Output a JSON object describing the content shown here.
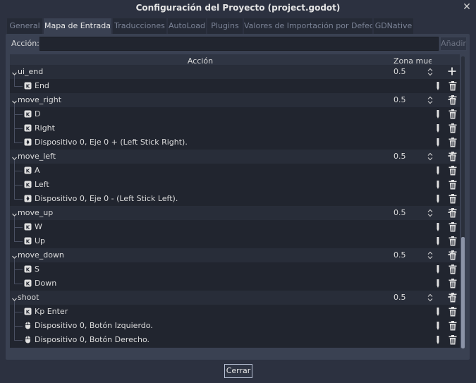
{
  "window": {
    "title": "Configuración del Proyecto (project.godot)"
  },
  "tabs": [
    {
      "label": "General",
      "active": false
    },
    {
      "label": "Mapa de Entrada",
      "active": true
    },
    {
      "label": "Traducciones",
      "active": false
    },
    {
      "label": "AutoLoad",
      "active": false
    },
    {
      "label": "Plugins",
      "active": false
    },
    {
      "label": "Valores de Importación por Defecto",
      "active": false
    },
    {
      "label": "GDNative",
      "active": false
    }
  ],
  "action_bar": {
    "label": "Acción:",
    "input_value": "",
    "add_button": "Añadir"
  },
  "tree": {
    "header_action": "Acción",
    "header_deadzone": "Zona muer",
    "rows": [
      {
        "type": "action",
        "name": "ui_end",
        "deadzone": "0.5"
      },
      {
        "type": "event",
        "icon": "keyboard-icon",
        "name": "End"
      },
      {
        "type": "action",
        "name": "move_right",
        "deadzone": "0.5"
      },
      {
        "type": "event",
        "icon": "keyboard-icon",
        "name": "D"
      },
      {
        "type": "event",
        "icon": "keyboard-icon",
        "name": "Right"
      },
      {
        "type": "event",
        "icon": "joypad-axis-icon",
        "name": "Dispositivo 0, Eje 0 + (Left Stick Right)."
      },
      {
        "type": "action",
        "name": "move_left",
        "deadzone": "0.5"
      },
      {
        "type": "event",
        "icon": "keyboard-icon",
        "name": "A"
      },
      {
        "type": "event",
        "icon": "keyboard-icon",
        "name": "Left"
      },
      {
        "type": "event",
        "icon": "joypad-axis-icon",
        "name": "Dispositivo 0, Eje 0 - (Left Stick Left)."
      },
      {
        "type": "action",
        "name": "move_up",
        "deadzone": "0.5"
      },
      {
        "type": "event",
        "icon": "keyboard-icon",
        "name": "W"
      },
      {
        "type": "event",
        "icon": "keyboard-icon",
        "name": "Up"
      },
      {
        "type": "action",
        "name": "move_down",
        "deadzone": "0.5"
      },
      {
        "type": "event",
        "icon": "keyboard-icon",
        "name": "S"
      },
      {
        "type": "event",
        "icon": "keyboard-icon",
        "name": "Down"
      },
      {
        "type": "action",
        "name": "shoot",
        "deadzone": "0.5"
      },
      {
        "type": "event",
        "icon": "keyboard-icon",
        "name": "Kp Enter"
      },
      {
        "type": "event",
        "icon": "mouse-icon",
        "name": "Dispositivo 0, Botón Izquierdo."
      },
      {
        "type": "event",
        "icon": "mouse-icon",
        "name": "Dispositivo 0, Botón Derecho."
      }
    ]
  },
  "footer": {
    "close_button": "Cerrar"
  }
}
